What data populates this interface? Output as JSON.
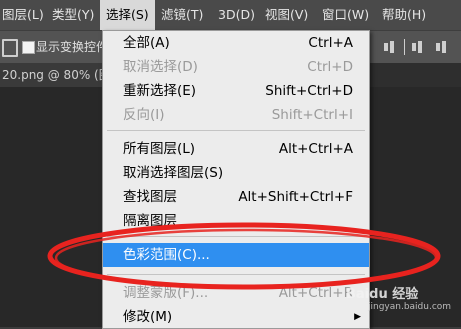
{
  "menubar": {
    "items": [
      "图层(L)",
      "类型(Y)",
      "选择(S)",
      "滤镜(T)",
      "3D(D)",
      "视图(V)",
      "窗口(W)",
      "帮助(H)"
    ],
    "active_index": 2
  },
  "options": {
    "show_transform_label": "显示变换控件"
  },
  "document": {
    "tab_label": "20.png @ 80% (图层"
  },
  "select_menu": {
    "items": [
      {
        "label": "全部(A)",
        "shortcut": "Ctrl+A",
        "disabled": false
      },
      {
        "label": "取消选择(D)",
        "shortcut": "Ctrl+D",
        "disabled": true
      },
      {
        "label": "重新选择(E)",
        "shortcut": "Shift+Ctrl+D",
        "disabled": false
      },
      {
        "label": "反向(I)",
        "shortcut": "Shift+Ctrl+I",
        "disabled": true
      },
      {
        "label": "所有图层(L)",
        "shortcut": "Alt+Ctrl+A",
        "disabled": false
      },
      {
        "label": "取消选择图层(S)",
        "shortcut": "",
        "disabled": false
      },
      {
        "label": "查找图层",
        "shortcut": "Alt+Shift+Ctrl+F",
        "disabled": false
      },
      {
        "label": "隔离图层",
        "shortcut": "",
        "disabled": false
      },
      {
        "label": "色彩范围(C)...",
        "shortcut": "",
        "disabled": false,
        "highlighted": true
      },
      {
        "label": "调整蒙版(F)...",
        "shortcut": "Alt+Ctrl+R",
        "disabled": true
      },
      {
        "label": "修改(M)",
        "shortcut": "",
        "disabled": false,
        "submenu": true
      }
    ]
  },
  "watermark": {
    "text": "Baidu 经验",
    "url": "jingyan.baidu.com"
  },
  "colors": {
    "highlight": "#2f8ff0",
    "annotation": "#e8231f"
  }
}
